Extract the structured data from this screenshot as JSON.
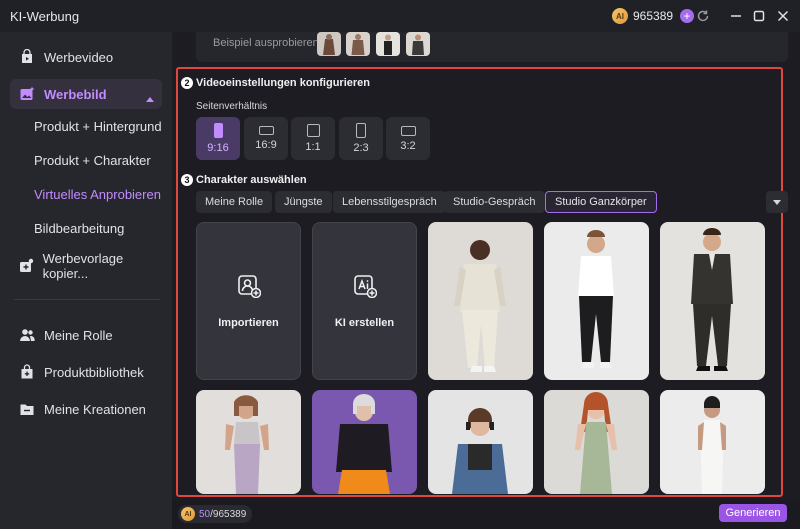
{
  "window": {
    "title": "KI-Werbung",
    "credits": "965389",
    "coin_glyph": "AI"
  },
  "sidebar": {
    "items": [
      {
        "label": "Werbevideo",
        "icon": "video-icon"
      },
      {
        "label": "Werbebild",
        "icon": "image-sparkle-icon"
      },
      {
        "label": "Werbevorlage kopier...",
        "icon": "copy-template-icon"
      },
      {
        "label": "Meine Rolle",
        "icon": "people-icon"
      },
      {
        "label": "Produktbibliothek",
        "icon": "bag-icon"
      },
      {
        "label": "Meine Kreationen",
        "icon": "folder-icon"
      }
    ],
    "subitems": [
      "Produkt + Hintergrund",
      "Produkt + Charakter",
      "Virtuelles Anprobieren",
      "Bildbearbeitung"
    ],
    "selected_subitem": "Virtuelles Anprobieren"
  },
  "main": {
    "try_label": "Beispiel ausprobieren:",
    "step2": {
      "number": "2",
      "title": "Videoeinstellungen konfigurieren"
    },
    "aspect_label": "Seitenverhältnis",
    "ratios": [
      "9:16",
      "16:9",
      "1:1",
      "2:3",
      "3:2"
    ],
    "selected_ratio": "9:16",
    "step3": {
      "number": "3",
      "title": "Charakter auswählen"
    },
    "tabs": [
      "Meine Rolle",
      "Jüngste",
      "Lebensstilgespräch",
      "Studio-Gespräch",
      "Studio Ganzkörper"
    ],
    "selected_tab": "Studio Ganzkörper",
    "action_cards": [
      {
        "label": "Importieren",
        "icon": "person-plus-icon"
      },
      {
        "label": "KI erstellen",
        "icon": "ai-plus-icon"
      }
    ]
  },
  "footer": {
    "cost_used": "50",
    "cost_total": "/965389",
    "generate_label": "Generieren"
  },
  "colors": {
    "accent": "#a66cf0",
    "highlight_border": "#e0473f",
    "generate": "#9b55e6"
  }
}
